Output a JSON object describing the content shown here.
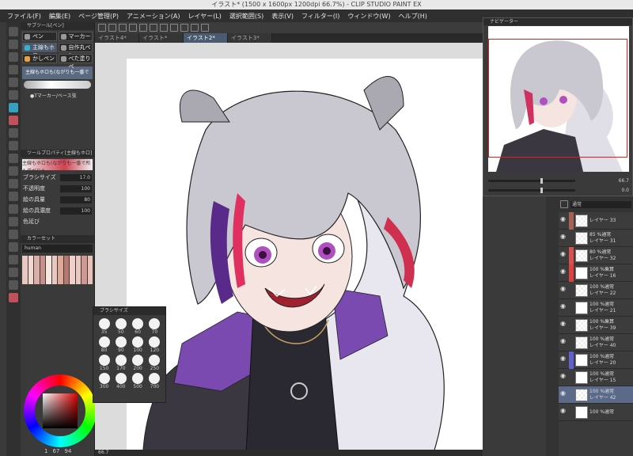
{
  "app": {
    "title": "イラスト* (1500 x 1600px 1200dpi 66.7%) - CLIP STUDIO PAINT EX"
  },
  "menu": [
    "ファイル(F)",
    "編集(E)",
    "ページ管理(P)",
    "アニメーション(A)",
    "レイヤー(L)",
    "選択範囲(S)",
    "表示(V)",
    "フィルター(I)",
    "ウィンドウ(W)",
    "ヘルプ(H)"
  ],
  "tabs": [
    {
      "label": "イラスト4*",
      "active": false
    },
    {
      "label": "イラスト*",
      "active": false
    },
    {
      "label": "イラスト2*",
      "active": true
    },
    {
      "label": "イラスト3*",
      "active": false
    }
  ],
  "subtool_panel": {
    "title": "サブツール[ペン]",
    "items": [
      {
        "label": "ペン",
        "selected": false
      },
      {
        "label": "マーカー",
        "selected": false
      },
      {
        "label": "主線もホロ",
        "selected": true
      },
      {
        "label": "自作丸ペン",
        "selected": false
      },
      {
        "label": "かしペン",
        "selected": false,
        "orange": true
      },
      {
        "label": "べた塗りペ",
        "selected": false
      }
    ],
    "current_brush": "主線もホロも(ながりも一番で",
    "sub_label": "●Tマーカー/ベース弦"
  },
  "tool_property": {
    "title": "ツールプロパティ[主線もホロ]",
    "preview_label": "主線もホロも(ながりも一番で所も描がりも",
    "rows": [
      {
        "label": "ブラシサイズ",
        "value": "17.0"
      },
      {
        "label": "不透明度",
        "value": "100"
      },
      {
        "label": "絵の具量",
        "value": "80"
      },
      {
        "label": "絵の具濃度",
        "value": "100"
      },
      {
        "label": "色延び",
        "value": ""
      }
    ]
  },
  "colorset": {
    "title": "カラーセット",
    "selected": "human"
  },
  "brush_size": {
    "title": "ブラシサイズ",
    "sizes": [
      "35",
      "50",
      "60",
      "70",
      "80",
      "90",
      "100",
      "120",
      "150",
      "170",
      "200",
      "250",
      "300",
      "400",
      "500",
      "700"
    ]
  },
  "navigator": {
    "title": "ナビゲーター",
    "zoom": "66.7",
    "rotate": "0.0"
  },
  "layers_panel": {
    "blend": "通常",
    "layers": [
      {
        "title": "レイヤー 33",
        "opacity": "",
        "thumb": "checker",
        "mark": "#a86050",
        "active": false
      },
      {
        "title": "レイヤー 31",
        "opacity": "85 %通常",
        "thumb": "checker",
        "mark": "",
        "active": false
      },
      {
        "title": "レイヤー 32",
        "opacity": "80 %通常",
        "thumb": "checker",
        "mark": "#d85050",
        "active": false
      },
      {
        "title": "レイヤー 16",
        "opacity": "100 %乗算",
        "thumb": "white",
        "mark": "#e04040",
        "active": false
      },
      {
        "title": "レイヤー 22",
        "opacity": "100 %通常",
        "thumb": "checker",
        "mark": "",
        "active": false
      },
      {
        "title": "レイヤー 21",
        "opacity": "100 %通常",
        "thumb": "white",
        "mark": "",
        "active": false
      },
      {
        "title": "レイヤー 39",
        "opacity": "100 %乗算",
        "thumb": "checker",
        "mark": "",
        "active": false
      },
      {
        "title": "レイヤー 40",
        "opacity": "100 %通常",
        "thumb": "checker",
        "mark": "",
        "active": false
      },
      {
        "title": "レイヤー 20",
        "opacity": "100 %通常",
        "thumb": "white",
        "mark": "#6060d0",
        "active": false
      },
      {
        "title": "レイヤー 15",
        "opacity": "100 %通常",
        "thumb": "white",
        "mark": "",
        "active": false
      },
      {
        "title": "レイヤー 42",
        "opacity": "100 %通常",
        "thumb": "checker",
        "mark": "",
        "active": true
      },
      {
        "title": "",
        "opacity": "100 %通常",
        "thumb": "white",
        "mark": "",
        "active": false
      }
    ]
  },
  "status": {
    "page": "1",
    "value1": "67",
    "value2": "94",
    "zoom": "66.7"
  },
  "colors": {
    "accent": "#4a5a70",
    "main_color": "#d02020"
  }
}
